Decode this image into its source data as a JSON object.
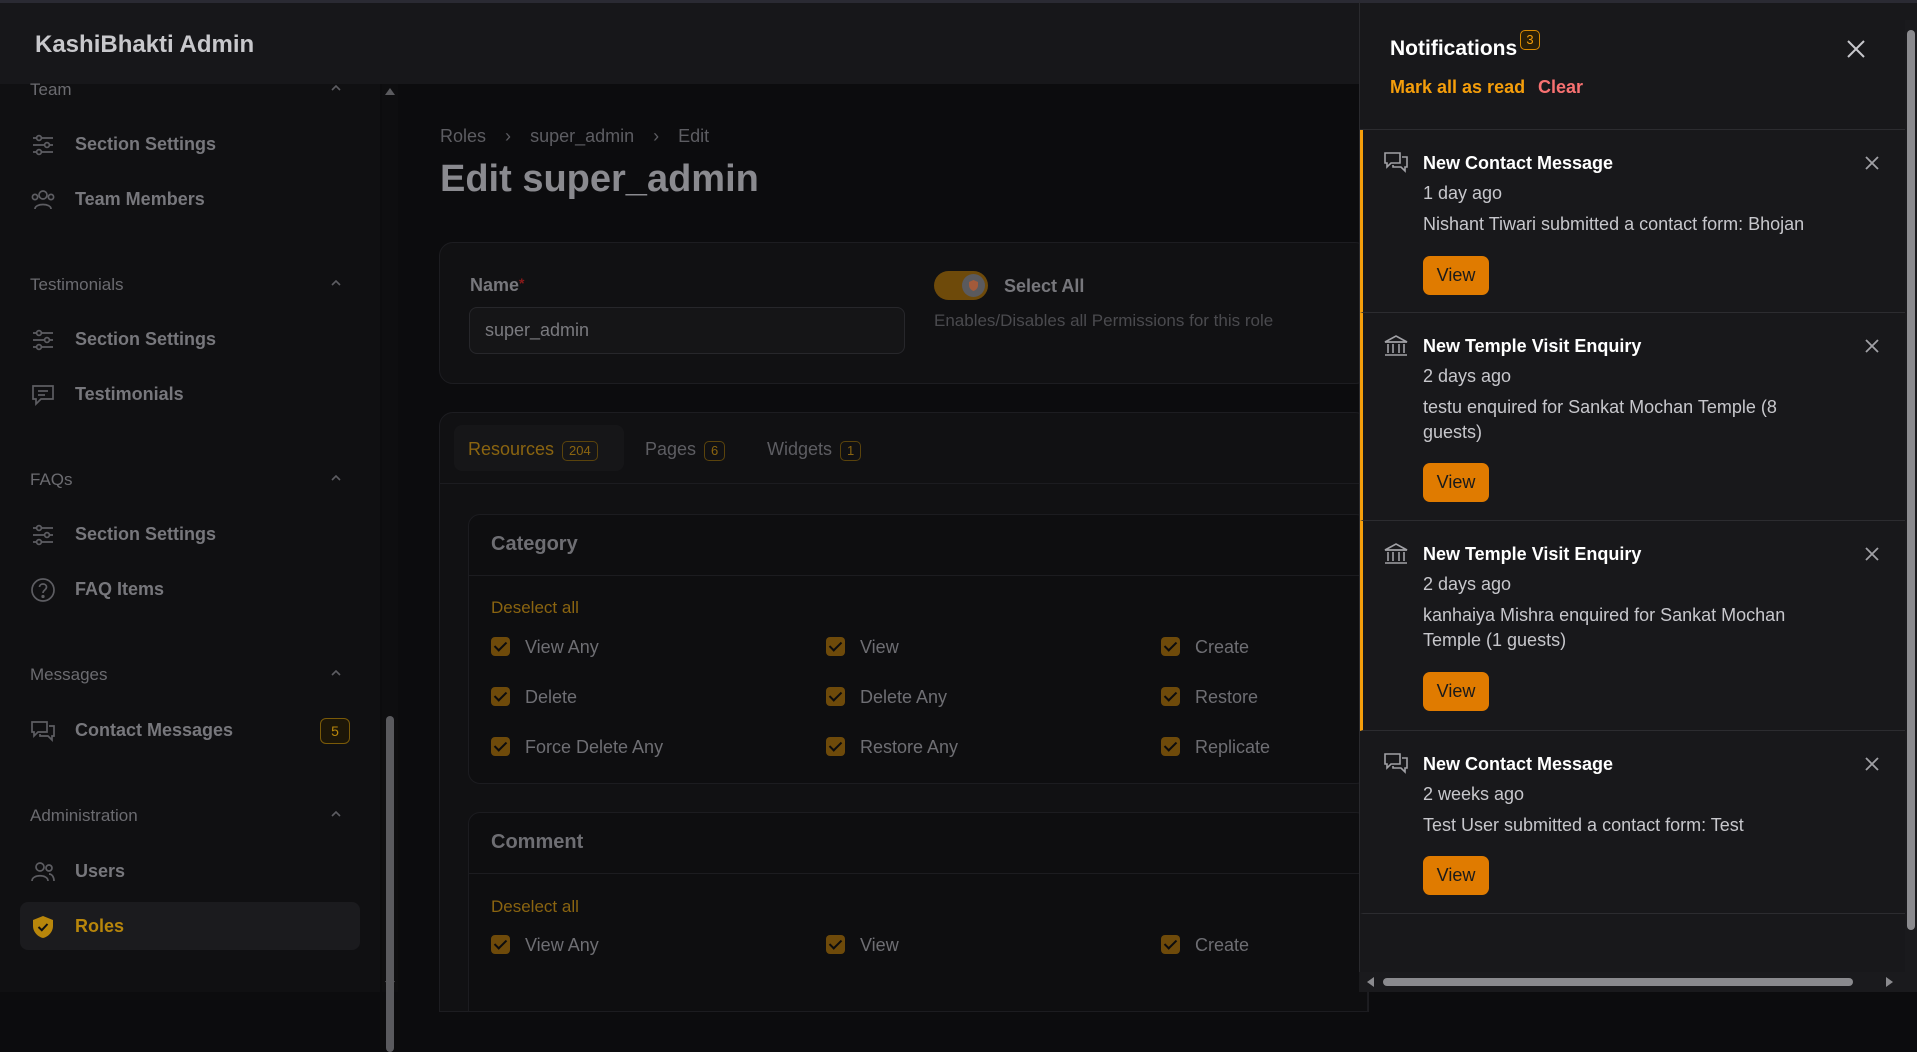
{
  "app": {
    "brand": "KashiBhakti Admin"
  },
  "sidebar": {
    "groups": [
      {
        "label": "Team",
        "items": [
          {
            "label": "Section Settings",
            "icon": "sliders-icon"
          },
          {
            "label": "Team Members",
            "icon": "users-icon"
          }
        ]
      },
      {
        "label": "Testimonials",
        "items": [
          {
            "label": "Section Settings",
            "icon": "sliders-icon"
          },
          {
            "label": "Testimonials",
            "icon": "chat-icon"
          }
        ]
      },
      {
        "label": "FAQs",
        "items": [
          {
            "label": "Section Settings",
            "icon": "sliders-icon"
          },
          {
            "label": "FAQ Items",
            "icon": "question-icon"
          }
        ]
      },
      {
        "label": "Messages",
        "items": [
          {
            "label": "Contact Messages",
            "icon": "chat-bubbles-icon",
            "badge": "5"
          }
        ]
      },
      {
        "label": "Administration",
        "items": [
          {
            "label": "Users",
            "icon": "users-icon"
          },
          {
            "label": "Roles",
            "icon": "shield-check-icon",
            "active": true
          }
        ]
      }
    ]
  },
  "breadcrumb": [
    "Roles",
    "super_admin",
    "Edit"
  ],
  "page_title": "Edit super_admin",
  "form": {
    "name_label": "Name",
    "name_required": "*",
    "name_value": "super_admin",
    "select_all_label": "Select All",
    "select_all_help": "Enables/Disables all Permissions for this role"
  },
  "tabs": [
    {
      "label": "Resources",
      "count": "204",
      "active": true
    },
    {
      "label": "Pages",
      "count": "6"
    },
    {
      "label": "Widgets",
      "count": "1"
    }
  ],
  "resources": [
    {
      "title": "Category",
      "deselect": "Deselect all",
      "permissions": [
        "View Any",
        "View",
        "Create",
        "Delete",
        "Delete Any",
        "Restore",
        "Force Delete Any",
        "Restore Any",
        "Replicate"
      ]
    },
    {
      "title": "Comment",
      "deselect": "Deselect all",
      "permissions": [
        "View Any",
        "View",
        "Create"
      ]
    }
  ],
  "notifications": {
    "title": "Notifications",
    "count": "3",
    "mark_all_read": "Mark all as read",
    "clear": "Clear",
    "view_label": "View",
    "items": [
      {
        "icon": "chat-bubbles-icon",
        "title": "New Contact Message",
        "time": "1 day ago",
        "body": "Nishant Tiwari submitted a contact form: Bhojan",
        "unread": true
      },
      {
        "icon": "temple-icon",
        "title": "New Temple Visit Enquiry",
        "time": "2 days ago",
        "body": "testu enquired for Sankat Mochan Temple (8 guests)",
        "unread": true
      },
      {
        "icon": "temple-icon",
        "title": "New Temple Visit Enquiry",
        "time": "2 days ago",
        "body": "kanhaiya Mishra enquired for Sankat Mochan Temple (1 guests)",
        "unread": true
      },
      {
        "icon": "chat-bubbles-icon",
        "title": "New Contact Message",
        "time": "2 weeks ago",
        "body": "Test User submitted a contact form: Test",
        "unread": false
      }
    ]
  },
  "colors": {
    "accent": "#f59e0b",
    "button": "#e07b00",
    "danger": "#f87171",
    "panel": "#18181b",
    "background": "#0c0c0e"
  }
}
